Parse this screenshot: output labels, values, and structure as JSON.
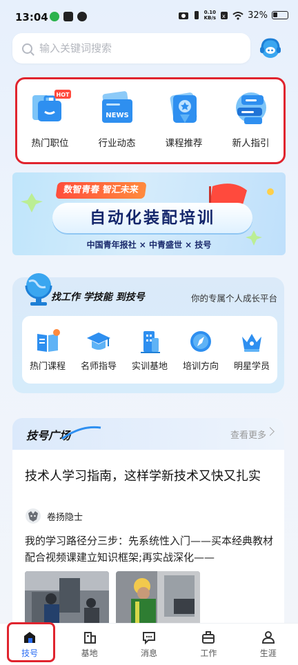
{
  "status_bar": {
    "time": "13:04",
    "net_speed_value": "0.10",
    "net_speed_unit": "KB/s",
    "battery": "32%"
  },
  "search": {
    "placeholder": "输入关键词搜索"
  },
  "quick_nav": [
    {
      "label": "热门职位",
      "badge": "HOT",
      "icon": "briefcase-icon"
    },
    {
      "label": "行业动态",
      "badge": "NEWS",
      "icon": "news-icon"
    },
    {
      "label": "课程推荐",
      "icon": "course-badge-icon"
    },
    {
      "label": "新人指引",
      "icon": "guide-cards-icon"
    }
  ],
  "banner": {
    "pill": "数智青春 智汇未来",
    "title": "自动化装配培训",
    "subtitle": "中国青年报社 × 中青盛世 × 技号"
  },
  "growth": {
    "slogan": "找工作 学技能 到技号",
    "tagline": "你的专属个人成长平台",
    "items": [
      {
        "label": "热门课程",
        "icon": "book-icon"
      },
      {
        "label": "名师指导",
        "icon": "graduation-cap-icon"
      },
      {
        "label": "实训基地",
        "icon": "building-icon"
      },
      {
        "label": "培训方向",
        "icon": "compass-icon"
      },
      {
        "label": "明星学员",
        "icon": "crown-icon"
      }
    ]
  },
  "plaza": {
    "title": "技号广场",
    "more": "查看更多",
    "article": {
      "title": "技术人学习指南，这样学新技术又快又扎实",
      "author": "卷扬隐士",
      "excerpt": "我的学习路径分三步：先系统性入门——买本经典教材配合视频课建立知识框架;再实战深化——"
    }
  },
  "tabbar": [
    {
      "label": "技号",
      "icon": "home-icon",
      "active": true
    },
    {
      "label": "基地",
      "icon": "base-building-icon",
      "active": false
    },
    {
      "label": "消息",
      "icon": "message-icon",
      "active": false
    },
    {
      "label": "工作",
      "icon": "work-bag-icon",
      "active": false
    },
    {
      "label": "生涯",
      "icon": "profile-icon",
      "active": false
    }
  ],
  "colors": {
    "accent": "#2a6df4",
    "annotation": "#e0242e"
  }
}
